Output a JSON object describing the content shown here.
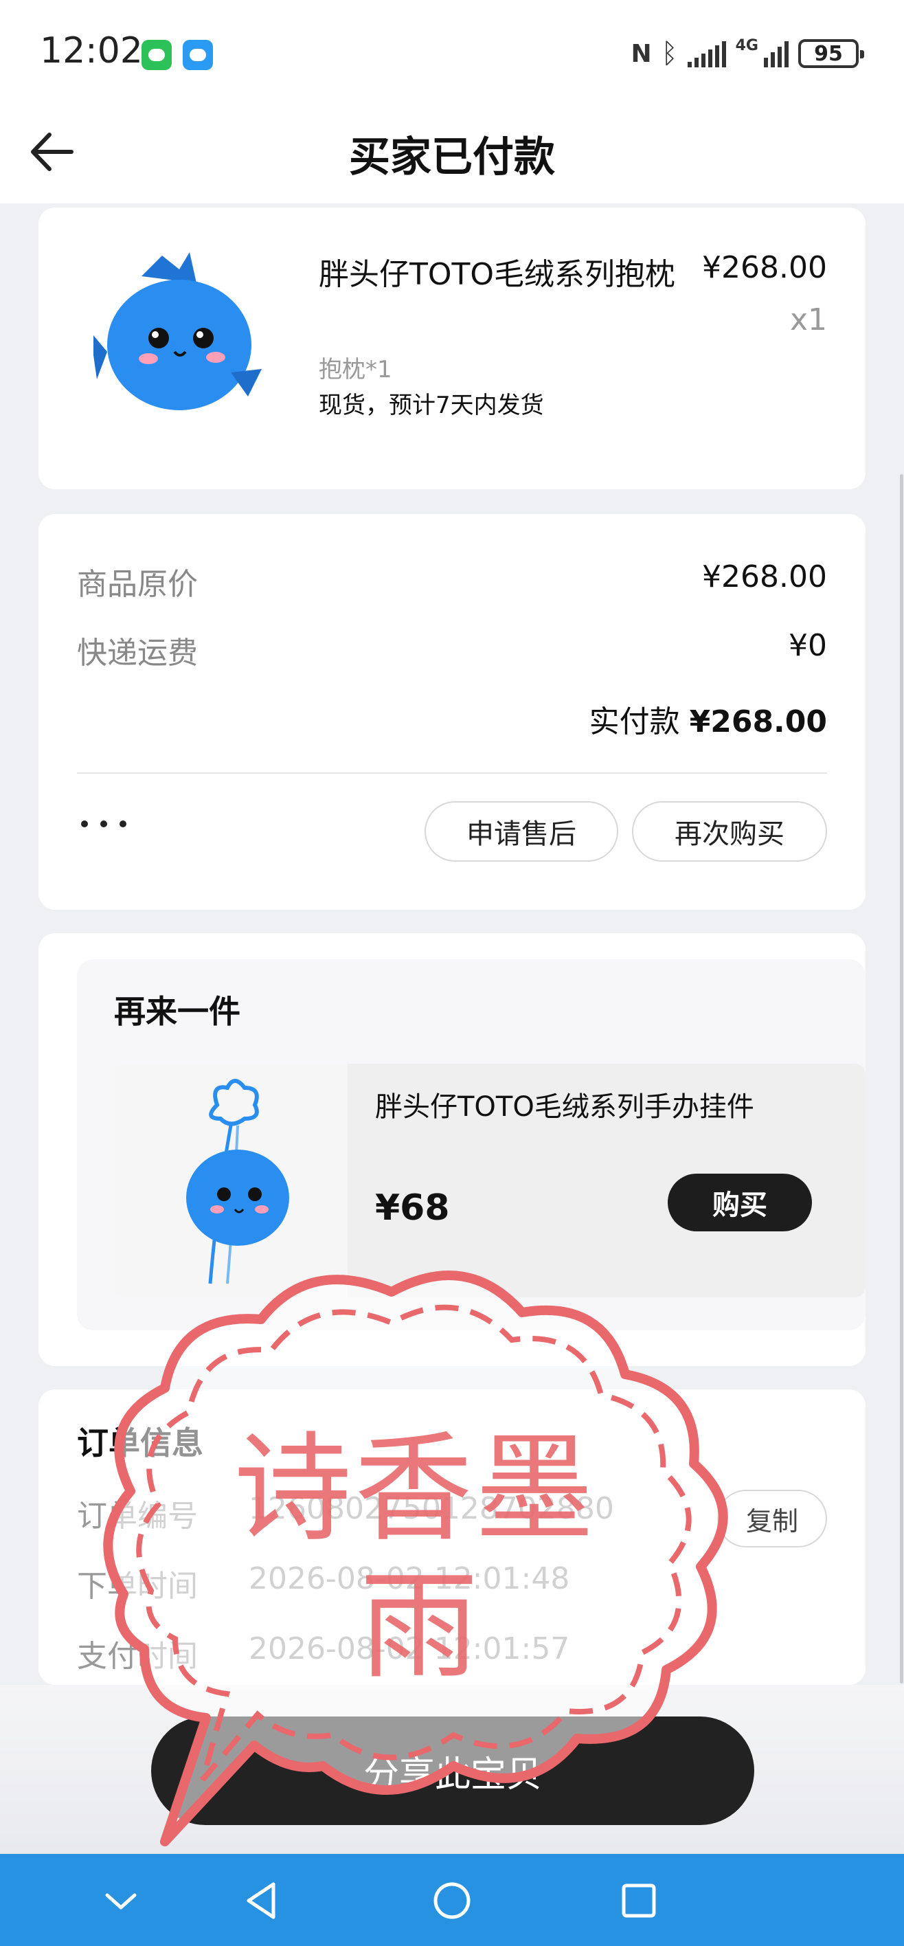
{
  "status": {
    "time": "12:02",
    "battery": "95",
    "network": "4G"
  },
  "header": {
    "title": "买家已付款"
  },
  "product": {
    "name": "胖头仔TOTO毛绒系列抱枕",
    "price": "¥268.00",
    "quantity": "x1",
    "spec": "抱枕*1",
    "shipping": "现货，预计7天内发货"
  },
  "price_summary": {
    "original_label": "商品原价",
    "original_value": "¥268.00",
    "shipping_label": "快递运费",
    "shipping_value": "¥0",
    "paid_label": "实付款",
    "paid_value": "¥268.00",
    "after_sale_label": "申请售后",
    "rebuy_label": "再次购买"
  },
  "rebuy": {
    "title": "再来一件",
    "item_name": "胖头仔TOTO毛绒系列手办挂件",
    "item_price": "¥68",
    "buy_label": "购买"
  },
  "order_info": {
    "title": "订单信息",
    "rows": [
      {
        "label": "订单编号",
        "value": "1260802750128702880"
      },
      {
        "label": "下单时间",
        "value": "2026-08-02 12:01:48"
      },
      {
        "label": "支付时间",
        "value": "2026-08-02 12:01:57"
      }
    ],
    "copy_label": "复制"
  },
  "share": {
    "label": "分享此宝贝"
  },
  "watermark": {
    "line1": "诗香墨",
    "line2": "雨"
  },
  "colors": {
    "nav_bar": "#2692e1",
    "stamp": "#e8686c",
    "button_dark": "#1d1d1d"
  }
}
